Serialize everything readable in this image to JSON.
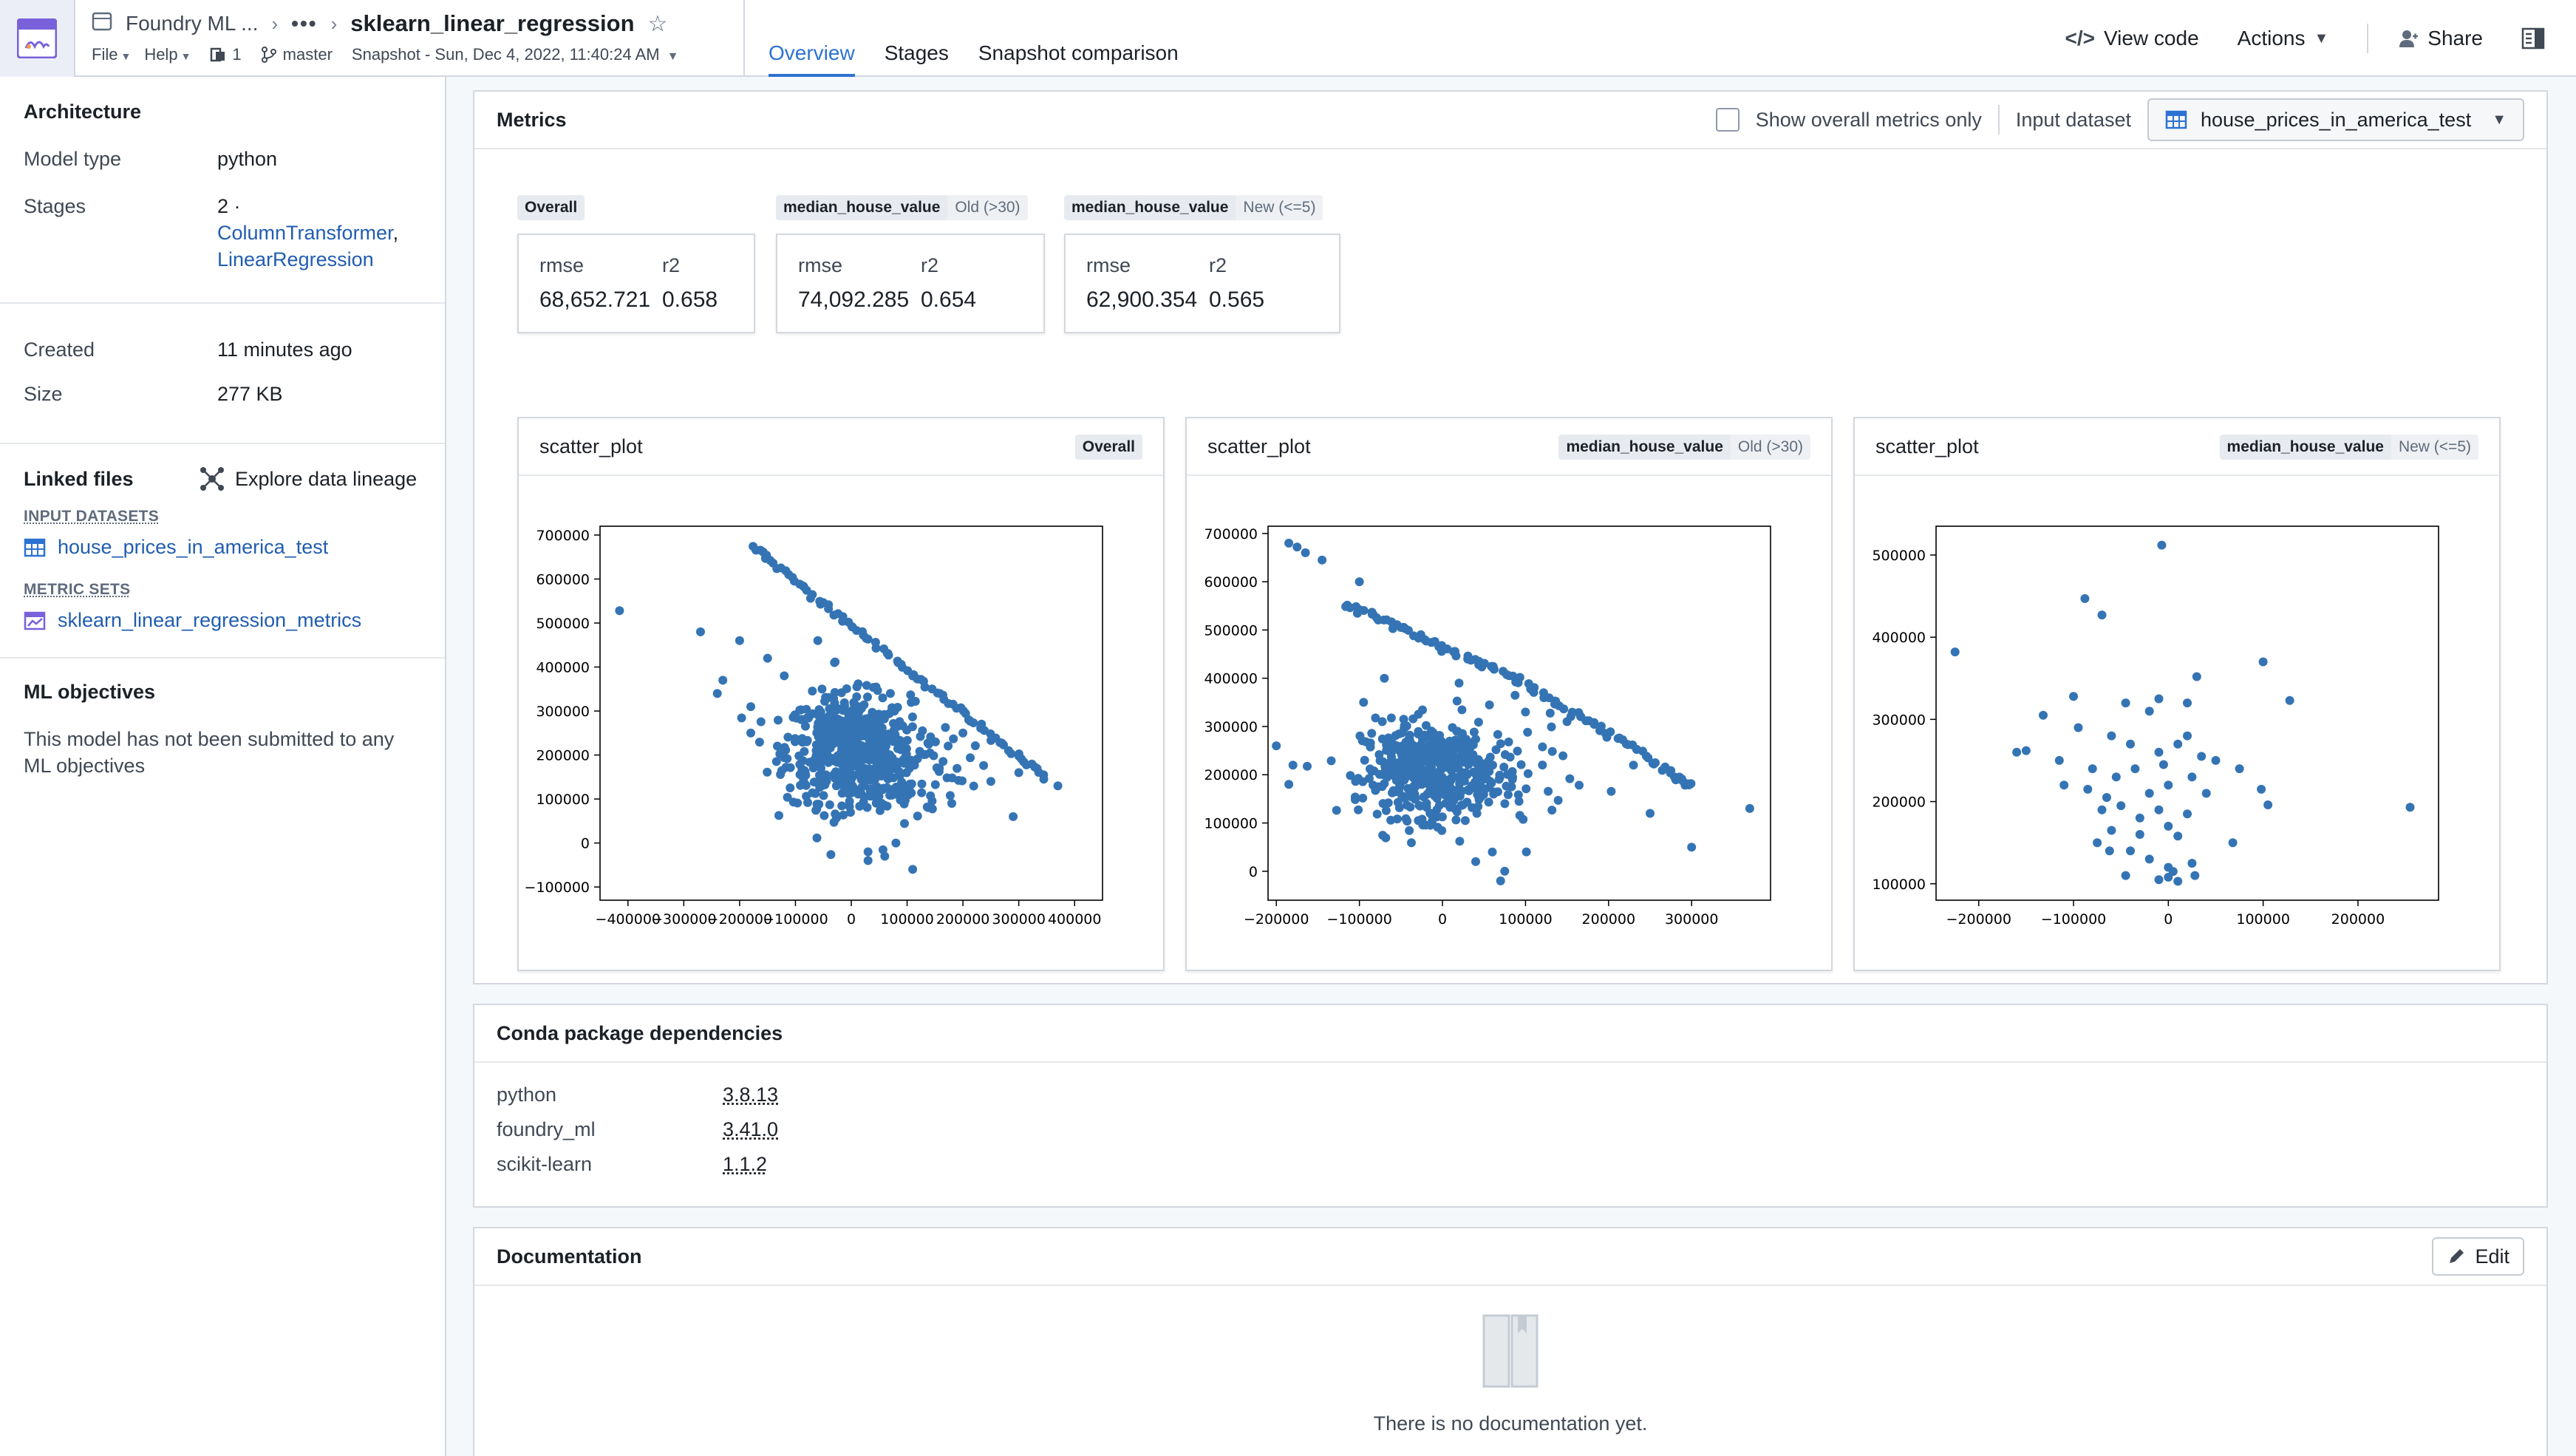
{
  "header": {
    "app_name": "Foundry ML ...",
    "title": "sklearn_linear_regression",
    "file_menu": "File",
    "help_menu": "Help",
    "branch_count": "1",
    "branch": "master",
    "snapshot": "Snapshot - Sun, Dec 4, 2022, 11:40:24 AM",
    "tabs": [
      "Overview",
      "Stages",
      "Snapshot comparison"
    ],
    "active_tab": 0,
    "view_code": "View code",
    "actions": "Actions",
    "share": "Share"
  },
  "sidebar": {
    "architecture_title": "Architecture",
    "model_type_label": "Model type",
    "model_type": "python",
    "stages_label": "Stages",
    "stages_count": "2 ·",
    "stage_1": "ColumnTransformer",
    "stage_2": "LinearRegression",
    "created_label": "Created",
    "created": "11 minutes ago",
    "size_label": "Size",
    "size": "277 KB",
    "linked_files_title": "Linked files",
    "explore_lineage": "Explore data lineage",
    "input_datasets_label": "INPUT DATASETS",
    "input_dataset": "house_prices_in_america_test",
    "metric_sets_label": "METRIC SETS",
    "metric_set": "sklearn_linear_regression_metrics",
    "ml_objectives_title": "ML objectives",
    "ml_objectives_text": "This model has not been submitted to any ML objectives"
  },
  "metrics": {
    "title": "Metrics",
    "show_overall_label": "Show overall metrics only",
    "input_dataset_label": "Input dataset",
    "input_dataset": "house_prices_in_america_test",
    "groups": [
      {
        "tag": "Overall",
        "sub": "",
        "rmse": "68,652.721",
        "r2": "0.658"
      },
      {
        "tag": "median_house_value",
        "sub": "Old (>30)",
        "rmse": "74,092.285",
        "r2": "0.654"
      },
      {
        "tag": "median_house_value",
        "sub": "New (<=5)",
        "rmse": "62,900.354",
        "r2": "0.565"
      }
    ],
    "rmse_label": "rmse",
    "r2_label": "r2"
  },
  "chart_data": [
    {
      "type": "scatter",
      "title": "scatter_plot",
      "tag": "Overall",
      "sub": "",
      "xlim": [
        -450000,
        450000
      ],
      "ylim": [
        -130000,
        720000
      ],
      "xticks": [
        -400000,
        -300000,
        -200000,
        -100000,
        0,
        100000,
        200000,
        300000,
        400000
      ],
      "xtick_labels": [
        "−400000",
        "−300000",
        "−200000",
        "−100000",
        "0",
        "100000",
        "200000",
        "300000",
        "400000"
      ],
      "yticks": [
        -100000,
        0,
        100000,
        200000,
        300000,
        400000,
        500000,
        600000,
        700000
      ],
      "ytick_labels": [
        "−100000",
        "0",
        "100000",
        "200000",
        "300000",
        "400000",
        "500000",
        "600000",
        "700000"
      ],
      "edge": [
        [
          -175000,
          680000
        ],
        [
          -120000,
          620000
        ],
        [
          -60000,
          560000
        ],
        [
          0,
          500000
        ],
        [
          60000,
          440000
        ],
        [
          120000,
          380000
        ],
        [
          180000,
          320000
        ],
        [
          240000,
          260000
        ],
        [
          300000,
          200000
        ],
        [
          350000,
          150000
        ]
      ],
      "points": [
        [
          -415000,
          528000
        ],
        [
          -270000,
          480000
        ],
        [
          -200000,
          460000
        ],
        [
          -240000,
          340000
        ],
        [
          -230000,
          370000
        ],
        [
          -180000,
          310000
        ],
        [
          -180000,
          250000
        ],
        [
          -150000,
          420000
        ],
        [
          -120000,
          380000
        ],
        [
          -60000,
          460000
        ],
        [
          -30000,
          410000
        ],
        [
          70000,
          340000
        ],
        [
          200000,
          250000
        ],
        [
          300000,
          160000
        ],
        [
          370000,
          130000
        ],
        [
          290000,
          60000
        ],
        [
          250000,
          140000
        ],
        [
          180000,
          90000
        ],
        [
          30000,
          -20000
        ],
        [
          80000,
          0
        ],
        [
          110000,
          -60000
        ],
        [
          60000,
          -30000
        ],
        [
          30000,
          -40000
        ]
      ],
      "cloud": {
        "cx": -5000,
        "cy": 215000,
        "sx": 55000,
        "sy": 60000,
        "n": 520
      },
      "cloud2": {
        "cx": 70000,
        "cy": 170000,
        "sx": 70000,
        "sy": 65000,
        "n": 150
      }
    },
    {
      "type": "scatter",
      "title": "scatter_plot",
      "tag": "median_house_value",
      "sub": "Old (>30)",
      "xlim": [
        -210000,
        395000
      ],
      "ylim": [
        -60000,
        715000
      ],
      "xticks": [
        -200000,
        -100000,
        0,
        100000,
        200000,
        300000
      ],
      "xtick_labels": [
        "−200000",
        "−100000",
        "0",
        "100000",
        "200000",
        "300000"
      ],
      "yticks": [
        0,
        100000,
        200000,
        300000,
        400000,
        500000,
        600000,
        700000
      ],
      "ytick_labels": [
        "0",
        "100000",
        "200000",
        "300000",
        "400000",
        "500000",
        "600000",
        "700000"
      ],
      "edge": [
        [
          -120000,
          560000
        ],
        [
          -80000,
          530000
        ],
        [
          -40000,
          500000
        ],
        [
          0,
          470000
        ],
        [
          40000,
          440000
        ],
        [
          80000,
          410000
        ],
        [
          120000,
          370000
        ],
        [
          160000,
          330000
        ],
        [
          200000,
          290000
        ],
        [
          240000,
          250000
        ],
        [
          280000,
          200000
        ],
        [
          305000,
          180000
        ]
      ],
      "points": [
        [
          -185000,
          680000
        ],
        [
          -175000,
          672000
        ],
        [
          -165000,
          660000
        ],
        [
          -145000,
          645000
        ],
        [
          -100000,
          600000
        ],
        [
          -200000,
          260000
        ],
        [
          -180000,
          220000
        ],
        [
          -185000,
          180000
        ],
        [
          -95000,
          350000
        ],
        [
          -70000,
          400000
        ],
        [
          20000,
          390000
        ],
        [
          100000,
          330000
        ],
        [
          150000,
          310000
        ],
        [
          230000,
          220000
        ],
        [
          250000,
          120000
        ],
        [
          300000,
          50000
        ],
        [
          370000,
          130000
        ],
        [
          60000,
          40000
        ],
        [
          75000,
          0
        ],
        [
          70000,
          -20000
        ],
        [
          40000,
          20000
        ]
      ],
      "cloud": {
        "cx": -20000,
        "cy": 210000,
        "sx": 38000,
        "sy": 48000,
        "n": 380
      },
      "cloud2": {
        "cx": 40000,
        "cy": 190000,
        "sx": 55000,
        "sy": 60000,
        "n": 120
      }
    },
    {
      "type": "scatter",
      "title": "scatter_plot",
      "tag": "median_house_value",
      "sub": "New (<=5)",
      "xlim": [
        -245000,
        285000
      ],
      "ylim": [
        80000,
        535000
      ],
      "xticks": [
        -200000,
        -100000,
        0,
        100000,
        200000
      ],
      "xtick_labels": [
        "−200000",
        "−100000",
        "0",
        "100000",
        "200000"
      ],
      "yticks": [
        100000,
        200000,
        300000,
        400000,
        500000
      ],
      "ytick_labels": [
        "100000",
        "200000",
        "300000",
        "400000",
        "500000"
      ],
      "edge": [],
      "points": [
        [
          -7000,
          512000
        ],
        [
          -88000,
          447000
        ],
        [
          -70000,
          427000
        ],
        [
          -225000,
          382000
        ],
        [
          100000,
          370000
        ],
        [
          128000,
          323000
        ],
        [
          -100000,
          328000
        ],
        [
          -45000,
          320000
        ],
        [
          -10000,
          325000
        ],
        [
          20000,
          320000
        ],
        [
          -20000,
          310000
        ],
        [
          30000,
          352000
        ],
        [
          -132000,
          305000
        ],
        [
          -95000,
          290000
        ],
        [
          -60000,
          280000
        ],
        [
          -40000,
          270000
        ],
        [
          -10000,
          260000
        ],
        [
          10000,
          270000
        ],
        [
          20000,
          280000
        ],
        [
          -150000,
          262000
        ],
        [
          -160000,
          260000
        ],
        [
          -115000,
          250000
        ],
        [
          -80000,
          240000
        ],
        [
          -55000,
          230000
        ],
        [
          -35000,
          240000
        ],
        [
          -5000,
          245000
        ],
        [
          35000,
          255000
        ],
        [
          50000,
          250000
        ],
        [
          -110000,
          220000
        ],
        [
          -85000,
          215000
        ],
        [
          -65000,
          205000
        ],
        [
          -20000,
          210000
        ],
        [
          0,
          220000
        ],
        [
          25000,
          230000
        ],
        [
          40000,
          210000
        ],
        [
          75000,
          240000
        ],
        [
          98000,
          215000
        ],
        [
          -70000,
          190000
        ],
        [
          -50000,
          195000
        ],
        [
          -30000,
          180000
        ],
        [
          -10000,
          190000
        ],
        [
          20000,
          185000
        ],
        [
          -60000,
          165000
        ],
        [
          -30000,
          160000
        ],
        [
          0,
          170000
        ],
        [
          10000,
          158000
        ],
        [
          -40000,
          140000
        ],
        [
          -20000,
          130000
        ],
        [
          0,
          120000
        ],
        [
          5000,
          115000
        ],
        [
          25000,
          125000
        ],
        [
          -10000,
          105000
        ],
        [
          0,
          108000
        ],
        [
          10000,
          103000
        ],
        [
          28000,
          110000
        ],
        [
          255000,
          193000
        ],
        [
          105000,
          196000
        ],
        [
          68000,
          150000
        ],
        [
          -75000,
          150000
        ],
        [
          -62000,
          140000
        ],
        [
          -45000,
          110000
        ]
      ],
      "cloud": null,
      "cloud2": null
    }
  ],
  "dependencies": {
    "title": "Conda package dependencies",
    "items": [
      {
        "name": "python",
        "version": "3.8.13"
      },
      {
        "name": "foundry_ml",
        "version": "3.41.0"
      },
      {
        "name": "scikit-learn",
        "version": "1.1.2"
      }
    ]
  },
  "documentation": {
    "title": "Documentation",
    "edit_label": "Edit",
    "empty_text": "There is no documentation yet."
  },
  "colors": {
    "accent": "#2d72d2",
    "point": "#3474b4",
    "logo": "#7961db"
  },
  "icons": [
    "app-logo-icon",
    "model-icon",
    "chevron-right-icon",
    "more-icon",
    "star-icon",
    "branch-count-icon",
    "git-branch-icon",
    "code-icon",
    "user-icon",
    "panel-icon",
    "lineage-icon",
    "table-icon",
    "metric-set-icon",
    "pencil-icon",
    "book-icon"
  ]
}
